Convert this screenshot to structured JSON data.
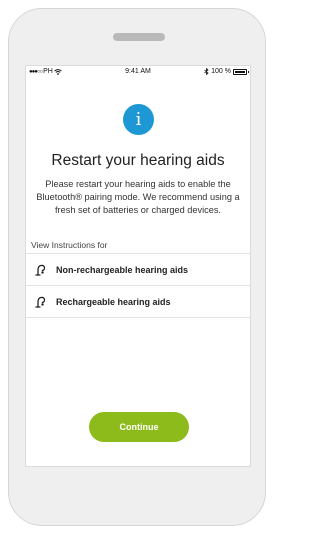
{
  "status_bar": {
    "carrier": "PH",
    "time": "9:41 AM",
    "battery": "100 %"
  },
  "header": {
    "info_glyph": "i",
    "title": "Restart your hearing aids",
    "description": "Please restart your hearing aids to enable the Bluetooth® pairing mode. We recommend using a fresh set of batteries or charged devices."
  },
  "instructions": {
    "label": "View Instructions for",
    "items": [
      {
        "label": "Non-rechargeable hearing aids",
        "icon": "hearing-aid-icon"
      },
      {
        "label": "Rechargeable hearing aids",
        "icon": "hearing-aid-icon"
      }
    ]
  },
  "actions": {
    "continue_label": "Continue"
  },
  "colors": {
    "accent_blue": "#1e98d4",
    "accent_green": "#8cbb1b"
  }
}
